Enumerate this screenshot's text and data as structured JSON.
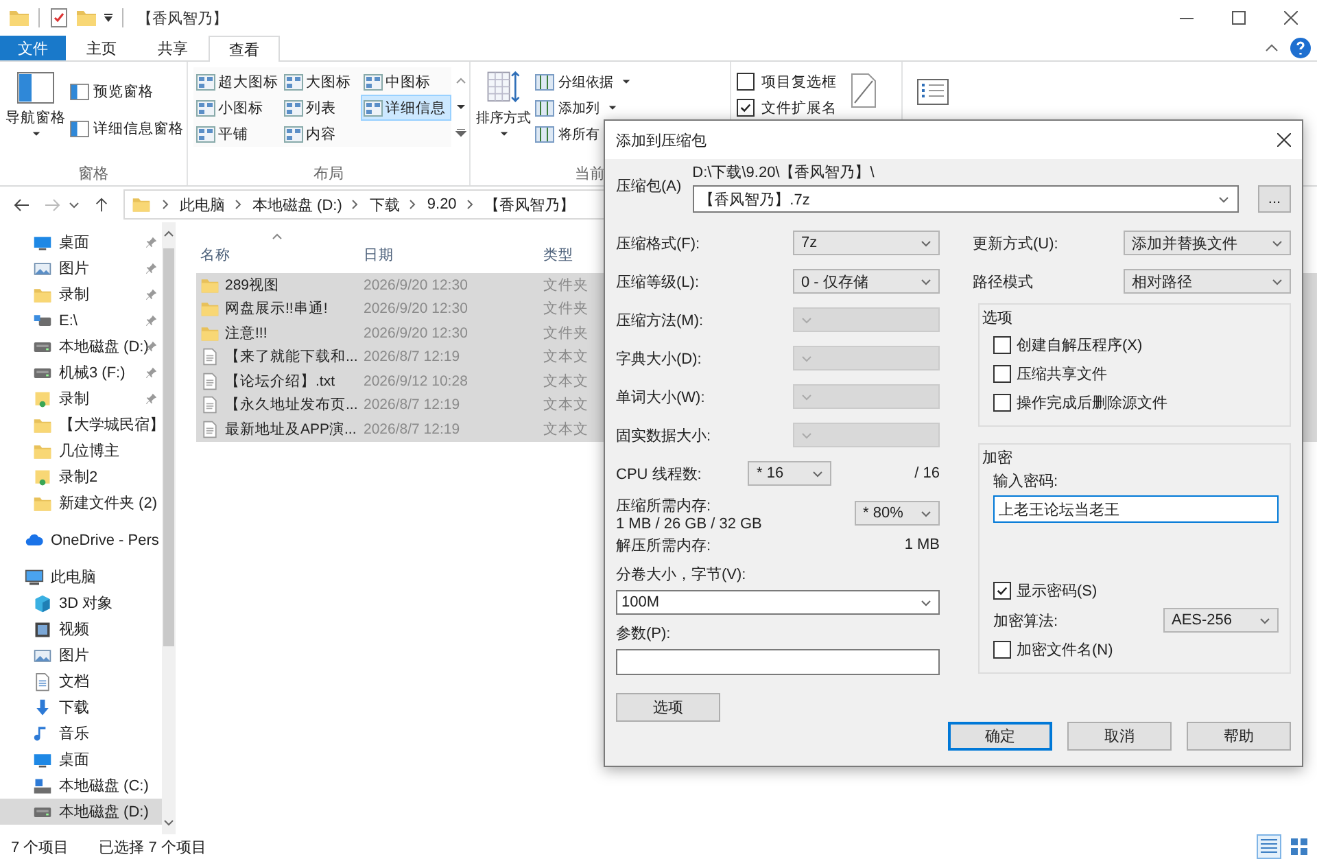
{
  "window": {
    "title": "【香风智乃】"
  },
  "ribbon": {
    "tabs": [
      {
        "label": "文件",
        "kind": "file",
        "selected": false
      },
      {
        "label": "主页",
        "kind": "tab",
        "selected": false
      },
      {
        "label": "共享",
        "kind": "tab",
        "selected": false
      },
      {
        "label": "查看",
        "kind": "tab",
        "selected": true
      }
    ],
    "panes": {
      "label": "窗格",
      "navigation": "导航窗格",
      "items": [
        "预览窗格",
        "详细信息窗格"
      ]
    },
    "layout": {
      "label": "布局",
      "items": [
        {
          "label": "超大图标",
          "selected": false
        },
        {
          "label": "大图标",
          "selected": false
        },
        {
          "label": "中图标",
          "selected": false
        },
        {
          "label": "小图标",
          "selected": false
        },
        {
          "label": "列表",
          "selected": false
        },
        {
          "label": "详细信息",
          "selected": true
        },
        {
          "label": "平铺",
          "selected": false
        },
        {
          "label": "内容",
          "selected": false
        }
      ]
    },
    "current_view": {
      "label": "当前",
      "sort": "排序方式",
      "items": [
        "分组依据",
        "添加列",
        "将所有"
      ]
    },
    "show_hide": {
      "checkboxes": [
        {
          "label": "项目复选框",
          "checked": false
        },
        {
          "label": "文件扩展名",
          "checked": true
        }
      ]
    }
  },
  "address": {
    "crumbs": [
      "此电脑",
      "本地磁盘 (D:)",
      "下载",
      "9.20",
      "【香风智乃】"
    ]
  },
  "nav": {
    "quick_access": [
      {
        "label": "桌面",
        "kind": "desktop",
        "pinned": true,
        "selected": false
      },
      {
        "label": "图片",
        "kind": "pictures",
        "pinned": true,
        "selected": false
      },
      {
        "label": "录制",
        "kind": "folder",
        "pinned": true,
        "selected": false
      },
      {
        "label": "E:\\",
        "kind": "netdrive",
        "pinned": true,
        "selected": false
      },
      {
        "label": "本地磁盘 (D:)",
        "kind": "drive",
        "pinned": true,
        "selected": false
      },
      {
        "label": "机械3 (F:)",
        "kind": "drive",
        "pinned": true,
        "selected": false
      },
      {
        "label": "录制",
        "kind": "userfolder",
        "pinned": true,
        "selected": false
      },
      {
        "label": "【大学城民宿】",
        "kind": "folder",
        "pinned": false,
        "selected": false
      },
      {
        "label": "几位博主",
        "kind": "folder",
        "pinned": false,
        "selected": false
      },
      {
        "label": "录制2",
        "kind": "userfolder",
        "pinned": false,
        "selected": false
      },
      {
        "label": "新建文件夹 (2)",
        "kind": "folder",
        "pinned": false,
        "selected": false
      }
    ],
    "onedrive": {
      "label": "OneDrive - Pers",
      "selected": false
    },
    "this_pc": {
      "label": "此电脑",
      "selected": false,
      "children": [
        {
          "label": "3D 对象",
          "kind": "cube",
          "selected": false
        },
        {
          "label": "视频",
          "kind": "video",
          "selected": false
        },
        {
          "label": "图片",
          "kind": "pictures",
          "selected": false
        },
        {
          "label": "文档",
          "kind": "document",
          "selected": false
        },
        {
          "label": "下载",
          "kind": "download",
          "selected": false
        },
        {
          "label": "音乐",
          "kind": "music",
          "selected": false
        },
        {
          "label": "桌面",
          "kind": "desktop",
          "selected": false
        },
        {
          "label": "本地磁盘 (C:)",
          "kind": "sysdrive",
          "selected": false
        },
        {
          "label": "本地磁盘 (D:)",
          "kind": "drive",
          "selected": true
        }
      ]
    }
  },
  "files": {
    "columns": [
      "名称",
      "日期",
      "类型"
    ],
    "rows": [
      {
        "name": "289视图",
        "date": "2026/9/20 12:30",
        "type": "文件夹",
        "kind": "folder",
        "selected": true
      },
      {
        "name": "网盘展示!!串通!",
        "date": "2026/9/20 12:30",
        "type": "文件夹",
        "kind": "folder",
        "selected": true
      },
      {
        "name": "注意!!!",
        "date": "2026/9/20 12:30",
        "type": "文件夹",
        "kind": "folder",
        "selected": true
      },
      {
        "name": "【来了就能下载和...",
        "date": "2026/8/7 12:19",
        "type": "文本文",
        "kind": "text",
        "selected": true
      },
      {
        "name": "【论坛介绍】.txt",
        "date": "2026/9/12 10:28",
        "type": "文本文",
        "kind": "text",
        "selected": true
      },
      {
        "name": "【永久地址发布页...",
        "date": "2026/8/7 12:19",
        "type": "文本文",
        "kind": "text",
        "selected": true
      },
      {
        "name": "最新地址及APP演...",
        "date": "2026/8/7 12:19",
        "type": "文本文",
        "kind": "text",
        "selected": true
      }
    ]
  },
  "status": {
    "items": "7 个项目",
    "selected": "已选择 7 个项目",
    "views": [
      {
        "kind": "details",
        "selected": true
      },
      {
        "kind": "tiles",
        "selected": false
      }
    ]
  },
  "dialog": {
    "title": "添加到压缩包",
    "archive": {
      "label": "压缩包(A)",
      "path": "D:\\下载\\9.20\\【香风智乃】\\",
      "name": "【香风智乃】.7z",
      "browse": "..."
    },
    "left": [
      {
        "kind": "select",
        "label": "压缩格式(F):",
        "value": "7z",
        "disabled": false
      },
      {
        "kind": "select",
        "label": "压缩等级(L):",
        "value": "0 - 仅存储",
        "disabled": false
      },
      {
        "kind": "select",
        "label": "压缩方法(M):",
        "disabled": true
      },
      {
        "kind": "select",
        "label": "字典大小(D):",
        "disabled": true
      },
      {
        "kind": "select",
        "label": "单词大小(W):",
        "disabled": true
      },
      {
        "kind": "select",
        "label": "固实数据大小:",
        "disabled": true
      },
      {
        "kind": "threads",
        "label": "CPU 线程数:",
        "value": "* 16",
        "total": "/ 16"
      },
      {
        "kind": "memory",
        "label": "压缩所需内存:",
        "detail": "1 MB / 26 GB / 32 GB",
        "value": "* 80%"
      },
      {
        "kind": "info",
        "label": "解压所需内存:",
        "value": "1 MB"
      }
    ],
    "split": {
      "label": "分卷大小，字节(V):",
      "value": "100M"
    },
    "params": {
      "label": "参数(P):"
    },
    "options_button": "选项",
    "update": {
      "label": "更新方式(U):",
      "value": "添加并替换文件"
    },
    "path_mode": {
      "label": "路径模式",
      "value": "相对路径"
    },
    "options": {
      "title": "选项",
      "checkboxes": [
        {
          "label": "创建自解压程序(X)",
          "checked": false
        },
        {
          "label": "压缩共享文件",
          "checked": false
        },
        {
          "label": "操作完成后删除源文件",
          "checked": false
        }
      ]
    },
    "encryption": {
      "title": "加密",
      "password_label": "输入密码:",
      "password": "上老王论坛当老王",
      "show_password": {
        "label": "显示密码(S)",
        "checked": true
      },
      "method_label": "加密算法:",
      "method": "AES-256",
      "encrypt_names": {
        "label": "加密文件名(N)",
        "checked": false
      }
    },
    "buttons": [
      {
        "label": "确定",
        "default": true
      },
      {
        "label": "取消",
        "default": false
      },
      {
        "label": "帮助",
        "default": false
      }
    ]
  }
}
